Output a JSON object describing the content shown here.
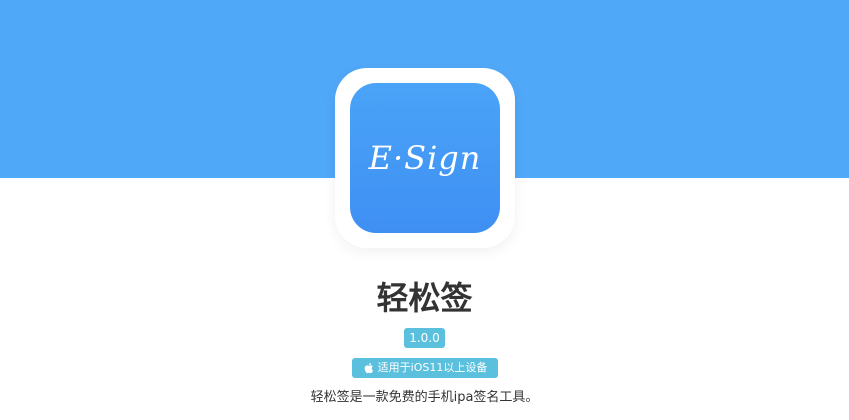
{
  "brand": {
    "primary_color": "#50a8f8",
    "badge_color": "#5bc0de"
  },
  "app": {
    "icon_text": "E·Sign",
    "name": "轻松签",
    "version": "1.0.0",
    "compatibility": "适用于iOS11以上设备",
    "compatibility_icon": "apple-icon",
    "description": "轻松签是一款免费的手机ipa签名工具。"
  }
}
